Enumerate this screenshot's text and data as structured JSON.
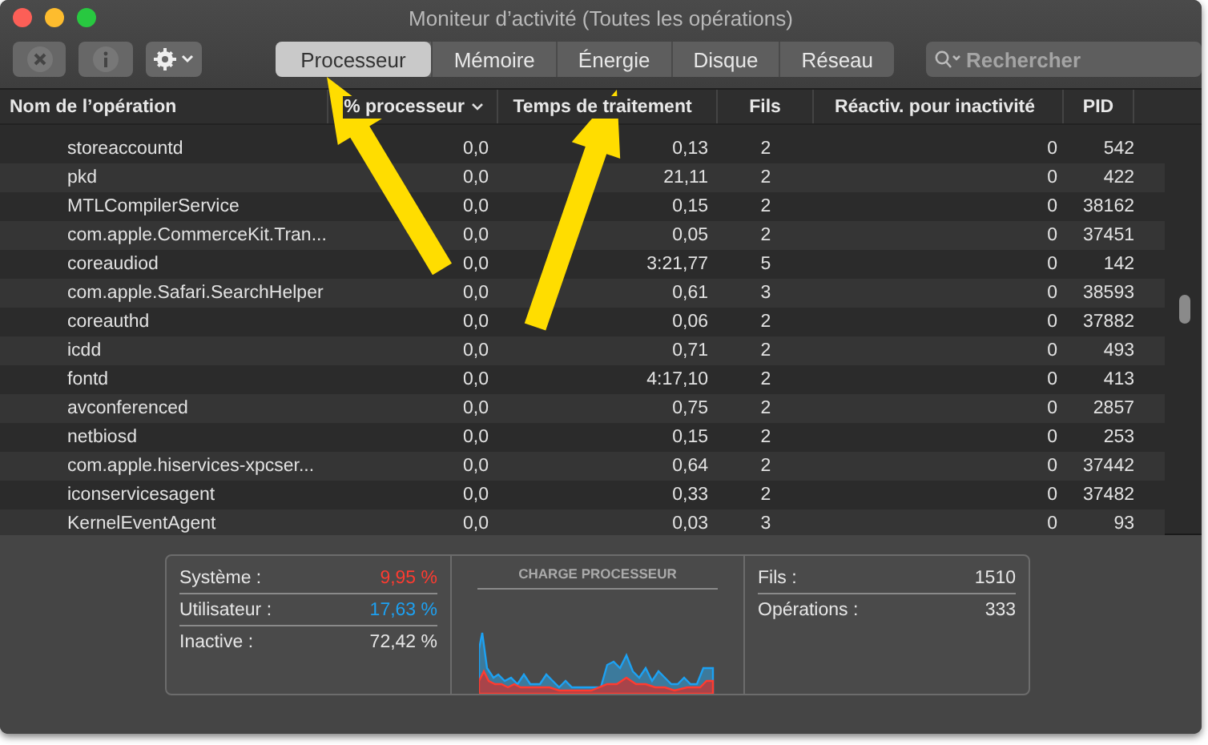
{
  "window": {
    "title": "Moniteur d’activité (Toutes les opérations)"
  },
  "tabs": [
    {
      "label": "Processeur",
      "selected": true
    },
    {
      "label": "Mémoire",
      "selected": false
    },
    {
      "label": "Énergie",
      "selected": false
    },
    {
      "label": "Disque",
      "selected": false
    },
    {
      "label": "Réseau",
      "selected": false
    }
  ],
  "search": {
    "placeholder": "Rechercher"
  },
  "table": {
    "columns": [
      {
        "label": "Nom de l’opération",
        "sorted": false
      },
      {
        "label": "% processeur",
        "sorted": true
      },
      {
        "label": "Temps de traitement",
        "sorted": false
      },
      {
        "label": "Fils",
        "sorted": false
      },
      {
        "label": "Réactiv. pour inactivité",
        "sorted": false
      },
      {
        "label": "PID",
        "sorted": false
      }
    ],
    "rows": [
      [
        "storeaccountd",
        "0,0",
        "0,13",
        "2",
        "0",
        "542"
      ],
      [
        "pkd",
        "0,0",
        "21,11",
        "2",
        "0",
        "422"
      ],
      [
        "MTLCompilerService",
        "0,0",
        "0,15",
        "2",
        "0",
        "38162"
      ],
      [
        "com.apple.CommerceKit.Tran...",
        "0,0",
        "0,05",
        "2",
        "0",
        "37451"
      ],
      [
        "coreaudiod",
        "0,0",
        "3:21,77",
        "5",
        "0",
        "142"
      ],
      [
        "com.apple.Safari.SearchHelper",
        "0,0",
        "0,61",
        "3",
        "0",
        "38593"
      ],
      [
        "coreauthd",
        "0,0",
        "0,06",
        "2",
        "0",
        "37882"
      ],
      [
        "icdd",
        "0,0",
        "0,71",
        "2",
        "0",
        "493"
      ],
      [
        "fontd",
        "0,0",
        "4:17,10",
        "2",
        "0",
        "413"
      ],
      [
        "avconferenced",
        "0,0",
        "0,75",
        "2",
        "0",
        "2857"
      ],
      [
        "netbiosd",
        "0,0",
        "0,15",
        "2",
        "0",
        "253"
      ],
      [
        "com.apple.hiservices-xpcser...",
        "0,0",
        "0,64",
        "2",
        "0",
        "37442"
      ],
      [
        "iconservicesagent",
        "0,0",
        "0,33",
        "2",
        "0",
        "37482"
      ],
      [
        "KernelEventAgent",
        "0,0",
        "0,03",
        "3",
        "0",
        "93"
      ]
    ]
  },
  "summary": {
    "cpu_stats": [
      {
        "label": "Système :",
        "value": "9,95 %",
        "color": "#ff3b30"
      },
      {
        "label": "Utilisateur :",
        "value": "17,63 %",
        "color": "#1da1f2"
      },
      {
        "label": "Inactive :",
        "value": "72,42 %",
        "color": "#e6e6e6"
      }
    ],
    "chart_title": "CHARGE PROCESSEUR",
    "counts": [
      {
        "label": "Fils :",
        "value": "1510"
      },
      {
        "label": "Opérations :",
        "value": "333"
      }
    ]
  }
}
